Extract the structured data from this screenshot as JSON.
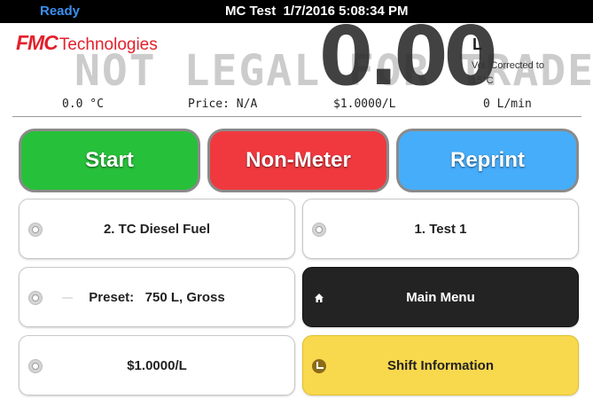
{
  "status_bar": {
    "state": "Ready",
    "title": "MC Test  1/7/2016 5:08:34 PM"
  },
  "header": {
    "logo_mark": "FMC",
    "logo_text": "Technologies",
    "watermark": "NOT LEGAL FOR TRADE",
    "volume": "0.00",
    "volume_unit": "L",
    "volume_note": "Vol. Corrected to 15°C"
  },
  "readouts": {
    "temperature": "0.0 °C",
    "price": "Price: N/A",
    "rate": "$1.0000/L",
    "flow": "0 L/min"
  },
  "actions": {
    "start": "Start",
    "non_meter": "Non-Meter",
    "reprint": "Reprint"
  },
  "tiles": {
    "product": "2. TC Diesel Fuel",
    "meter": "1. Test 1",
    "preset": "Preset:   750 L, Gross",
    "main_menu": "Main Menu",
    "unit_price": "$1.0000/L",
    "shift_info": "Shift Information"
  },
  "colors": {
    "start": "#27c03a",
    "non_meter": "#f0393f",
    "reprint": "#46adfb",
    "main_menu": "#232323",
    "shift_info": "#f8d84d",
    "brand": "#e3202b",
    "ready": "#3b8ff0"
  },
  "icons": {
    "settings": "gear-icon",
    "home": "home-icon",
    "shift": "clock-icon"
  }
}
